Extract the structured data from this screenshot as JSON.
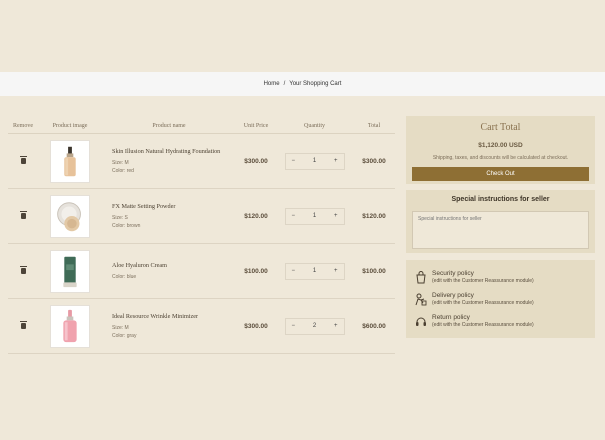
{
  "breadcrumb": {
    "home": "Home",
    "separator": "/",
    "current": "Your Shopping Cart"
  },
  "table": {
    "headers": {
      "remove": "Remove",
      "image": "Product image",
      "name": "Product name",
      "price": "Unit Price",
      "quantity": "Quantity",
      "total": "Total"
    },
    "rows": [
      {
        "name": "Skin Illusion Natural Hydrating Foundation",
        "size": "Size: M",
        "color": "Color: red",
        "price": "$300.00",
        "qty": "1",
        "total": "$300.00",
        "minus": "−",
        "plus": "+"
      },
      {
        "name": "FX Matte Setting Powder",
        "size": "Size: S",
        "color": "Color: brown",
        "price": "$120.00",
        "qty": "1",
        "total": "$120.00",
        "minus": "−",
        "plus": "+"
      },
      {
        "name": "Aloe Hyaluron Cream",
        "color": "Color: blue",
        "price": "$100.00",
        "qty": "1",
        "total": "$100.00",
        "minus": "−",
        "plus": "+"
      },
      {
        "name": "Ideal Resource Wrinkle Minimizer",
        "size": "Size: M",
        "color": "Color: gray",
        "price": "$300.00",
        "qty": "2",
        "total": "$600.00",
        "minus": "−",
        "plus": "+"
      }
    ]
  },
  "summary": {
    "title": "Cart Total",
    "amount": "$1,120.00 USD",
    "note": "Shipping, taxes, and discounts will be calculated at checkout.",
    "checkout": "Check Out"
  },
  "instructions": {
    "title": "Special instructions for seller",
    "placeholder": "Special instructions for seller"
  },
  "policies": [
    {
      "icon": "shopping-bag-icon",
      "title": "Security policy",
      "sub": "(edit with the Customer Reassurance module)"
    },
    {
      "icon": "delivery-icon",
      "title": "Delivery policy",
      "sub": "(edit with the Customer Reassurance module)"
    },
    {
      "icon": "return-icon",
      "title": "Return policy",
      "sub": "(edit with the Customer Reassurance module)"
    }
  ],
  "colors": {
    "background": "#efe8d9",
    "panel": "#e5dcc4",
    "accent": "#8e6f34"
  }
}
